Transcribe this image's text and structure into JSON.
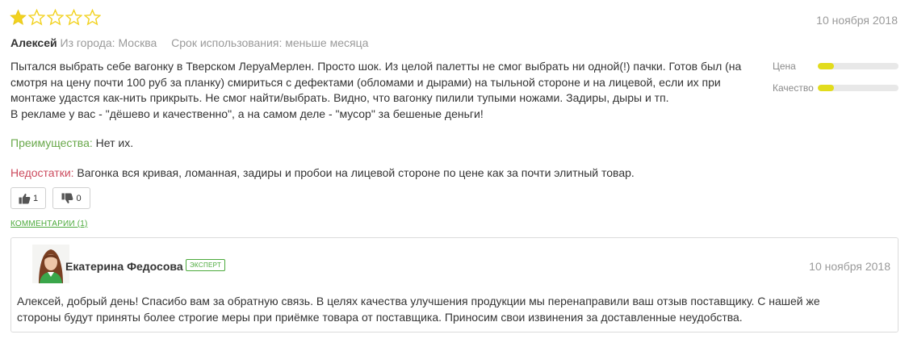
{
  "review": {
    "rating_stars": 1,
    "max_stars": 5,
    "date": "10 ноября 2018",
    "author": "Алексей",
    "city_label": "Из города:",
    "city": "Москва",
    "usage_label": "Срок использования:",
    "usage": "меньше месяца",
    "text_lines": [
      "Пытался выбрать себе вагонку в Тверском ЛеруаМерлен. Просто шок. Из целой палетты не смог выбрать ни одной(!) пачки. Готов был (на",
      "смотря на цену почти 100 руб за планку) смириться с дефектами (обломами и дырами) на тыльной стороне и на лицевой, если их при",
      "монтаже удастся как-нить прикрыть. Не смог найти/выбрать. Видно, что вагонку пилили тупыми ножами. Задиры, дыры и тп.",
      "В рекламе у вас - \"дёшево и качественно\", а на самом деле - \"мусор\" за бешеные деньги!"
    ],
    "pros_label": "Преимущества:",
    "pros": "Нет их.",
    "cons_label": "Недостатки:",
    "cons": "Вагонка вся кривая, ломанная, задиры и пробои на лицевой стороне по цене как за почти элитный товар.",
    "likes": "1",
    "dislikes": "0",
    "comments_link": "КОММЕНТАРИИ (1)"
  },
  "ratings": [
    {
      "label": "Цена",
      "value": 0.2
    },
    {
      "label": "Качество",
      "value": 0.2
    }
  ],
  "reply": {
    "name": "Екатерина Федосова",
    "badge": "ЭКСПЕРТ",
    "date": "10 ноября 2018",
    "text_lines": [
      "Алексей, добрый день! Спасибо вам за обратную связь. В целях качества улучшения продукции мы перенаправили ваш отзыв поставщику. С нашей же",
      "стороны будут приняты более строгие меры при приёмке товара от поставщика. Приносим свои извинения за доставленные неудобства."
    ]
  },
  "colors": {
    "star_filled": "#f2d21f",
    "star_empty": "#f2d21f",
    "rating_fill": "#e2dc1d",
    "pros_label": "#69a84a",
    "cons_label": "#cc4b5e",
    "link": "#4caa3c"
  },
  "icons": {
    "like": "thumbs-up-icon",
    "dislike": "thumbs-down-icon"
  }
}
